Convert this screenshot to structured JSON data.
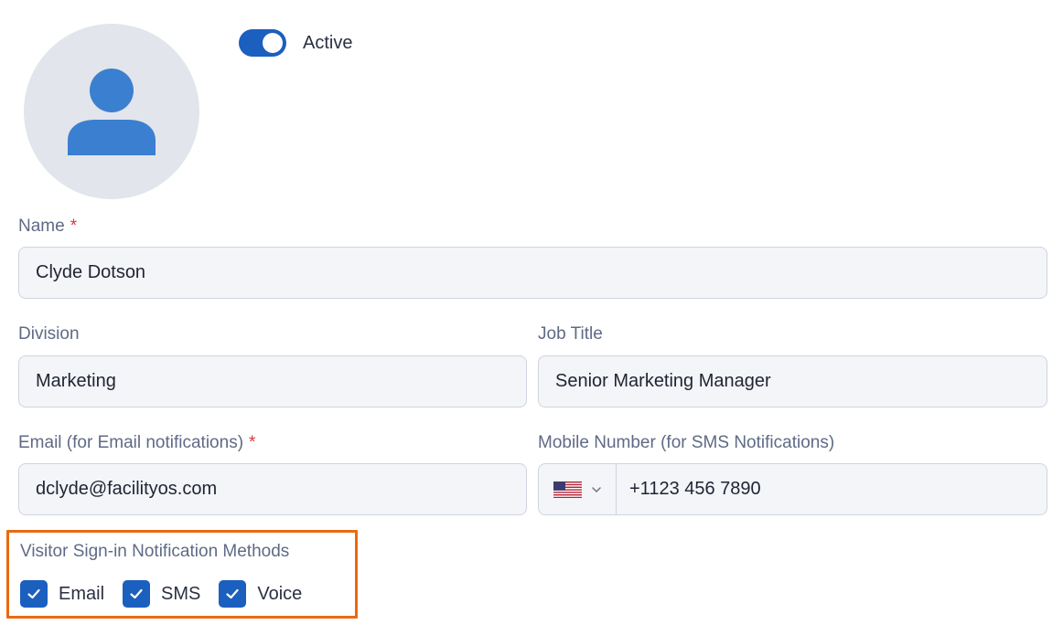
{
  "profile": {
    "avatar_icon": "user-icon",
    "active_toggle": {
      "label": "Active",
      "on": true
    }
  },
  "fields": {
    "name": {
      "label": "Name",
      "required_mark": "*",
      "value": "Clyde Dotson"
    },
    "division": {
      "label": "Division",
      "value": "Marketing"
    },
    "job_title": {
      "label": "Job Title",
      "value": "Senior Marketing Manager"
    },
    "email": {
      "label": "Email (for Email notifications)",
      "required_mark": "*",
      "value": "dclyde@facilityos.com"
    },
    "mobile": {
      "label": "Mobile Number (for SMS Notifications)",
      "country_flag": "us-flag-icon",
      "value": "+1123 456 7890"
    }
  },
  "notifications": {
    "title": "Visitor Sign-in Notification Methods",
    "methods": [
      {
        "label": "Email",
        "checked": true
      },
      {
        "label": "SMS",
        "checked": true
      },
      {
        "label": "Voice",
        "checked": true
      }
    ]
  },
  "colors": {
    "accent": "#1b5fbf",
    "highlight_border": "#ea6a10",
    "required": "#d93a3a",
    "label": "#5f6a85"
  }
}
